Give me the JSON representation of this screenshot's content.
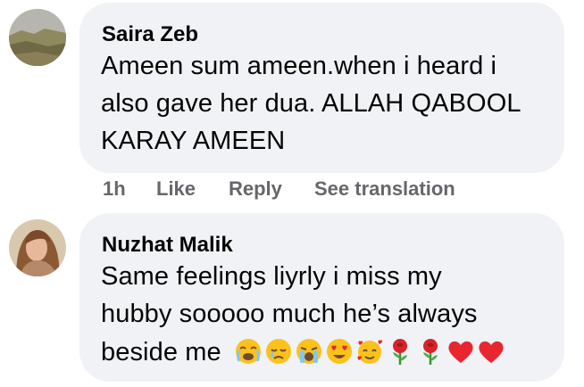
{
  "comments": [
    {
      "author": "Saira Zeb",
      "lines": [
        "Ameen sum ameen.when i heard i",
        "also gave her dua. ALLAH QABOOL",
        "KARAY AMEEN"
      ],
      "time": "1h",
      "actions": {
        "like": "Like",
        "reply": "Reply",
        "translate": "See translation"
      }
    },
    {
      "author": "Nuzhat Malik",
      "lines": [
        "Same feelings liyrly i miss my",
        "hubby sooooo much he’s always",
        "beside me"
      ],
      "emojis": [
        "sobbing-face-icon",
        "sad-face-icon",
        "crying-face-icon",
        "heart-eyes-face-icon",
        "smiling-face-hearts-icon",
        "rose-icon",
        "rose-icon",
        "red-heart-icon",
        "red-heart-icon"
      ]
    }
  ],
  "colors": {
    "bubble": "#f0f2f5",
    "text": "#050505",
    "meta": "#65676b",
    "heart": "#e8262f",
    "emoji_yellow": "#fcc21b"
  }
}
